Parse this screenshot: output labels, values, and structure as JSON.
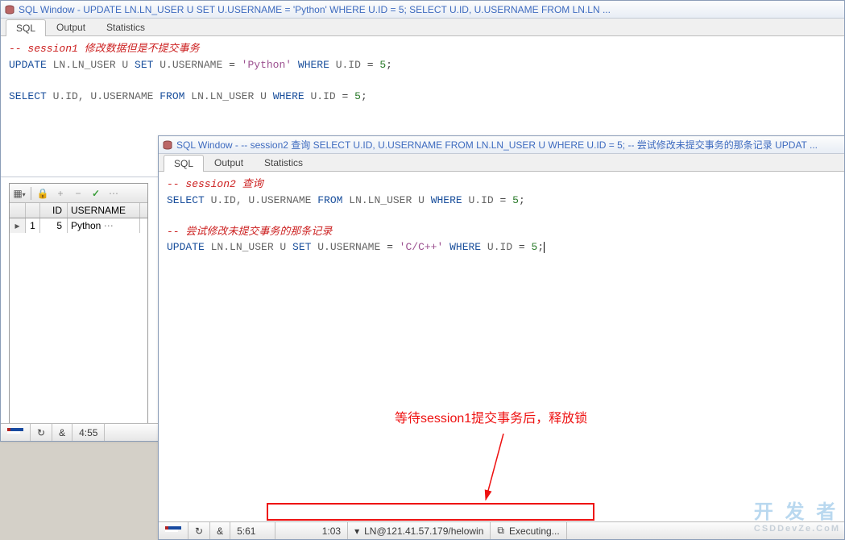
{
  "win1": {
    "title": "SQL Window - UPDATE LN.LN_USER U SET U.USERNAME = 'Python' WHERE U.ID = 5; SELECT U.ID, U.USERNAME FROM LN.LN ...",
    "tabs": [
      "SQL",
      "Output",
      "Statistics"
    ],
    "code": {
      "c1_pre": "-- session1 ",
      "c1_cn": "修改数据但是不提交事务",
      "l2_a": "UPDATE",
      "l2_b": " LN.LN_USER U ",
      "l2_c": "SET",
      "l2_d": " U.USERNAME ",
      "l2_e": "=",
      "l2_f": " 'Python' ",
      "l2_g": "WHERE",
      "l2_h": " U.ID ",
      "l2_i": "=",
      "l2_j": " 5",
      "l2_k": ";",
      "l3_a": "SELECT",
      "l3_b": " U.ID, U.USERNAME ",
      "l3_c": "FROM",
      "l3_d": " LN.LN_USER U ",
      "l3_e": "WHERE",
      "l3_f": " U.ID ",
      "l3_g": "=",
      "l3_h": " 5",
      "l3_i": ";"
    },
    "grid": {
      "cols": [
        "",
        "ID",
        "USERNAME"
      ],
      "row_ind": "▸",
      "row_idx": "1",
      "row_id": "5",
      "row_un": "Python",
      "ellipsis": "⋯"
    },
    "toolbar": {
      "lock": "🔒",
      "plus": "+",
      "minus": "−",
      "check": "✓",
      "dots": "⋯"
    },
    "status": {
      "refresh": "↻",
      "amp": "&",
      "cursor": "4:55"
    }
  },
  "win2": {
    "title": "SQL Window - -- session2 查询 SELECT U.ID, U.USERNAME FROM LN.LN_USER U WHERE U.ID = 5; -- 尝试修改未提交事务的那条记录 UPDAT ...",
    "tabs": [
      "SQL",
      "Output",
      "Statistics"
    ],
    "code": {
      "c1_pre": "-- session2 ",
      "c1_cn": "查询",
      "l2_a": "SELECT",
      "l2_b": " U.ID, U.USERNAME ",
      "l2_c": "FROM",
      "l2_d": " LN.LN_USER U ",
      "l2_e": "WHERE",
      "l2_f": " U.ID ",
      "l2_g": "=",
      "l2_h": " 5",
      "l2_i": ";",
      "c2_pre": "-- ",
      "c2_cn": "尝试修改未提交事务的那条记录",
      "l4_a": "UPDATE",
      "l4_b": " LN.LN_USER U ",
      "l4_c": "SET",
      "l4_d": " U.USERNAME ",
      "l4_e": "=",
      "l4_f": " 'C/C++' ",
      "l4_g": "WHERE",
      "l4_h": " U.ID ",
      "l4_i": "=",
      "l4_j": " 5",
      "l4_k": ";"
    },
    "status": {
      "refresh": "↻",
      "amp": "&",
      "cursor": "5:61",
      "elapsed": "1:03",
      "dropdown": "▾",
      "conn": "LN@121.41.57.179/helowin",
      "exec_label": "Executing..."
    }
  },
  "annotation": "等待session1提交事务后，释放锁",
  "watermark": {
    "main": "开 发 者",
    "sub": "CSDDevZe.CoM"
  }
}
